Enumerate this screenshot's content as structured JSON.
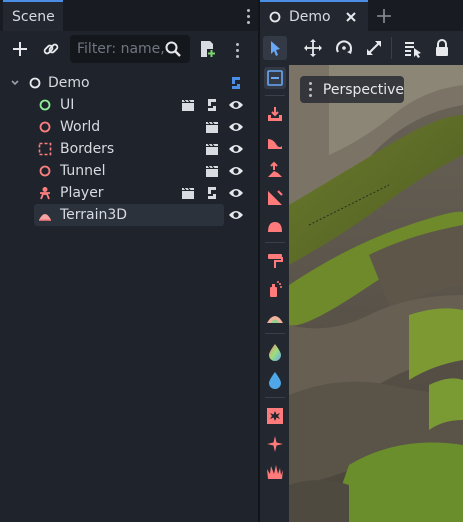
{
  "scene_dock": {
    "tab_label": "Scene",
    "filter_placeholder": "Filter: name,",
    "tree": [
      {
        "label": "Demo",
        "icon": "node3d-icon"
      },
      {
        "label": "UI",
        "icon": "control-icon"
      },
      {
        "label": "World",
        "icon": "node3d-icon"
      },
      {
        "label": "Borders",
        "icon": "node3d-icon"
      },
      {
        "label": "Tunnel",
        "icon": "node3d-icon"
      },
      {
        "label": "Player",
        "icon": "character-icon"
      },
      {
        "label": "Terrain3D",
        "icon": "terrain-icon"
      }
    ]
  },
  "viewport": {
    "tab_label": "Demo",
    "perspective_label": "Perspective"
  },
  "colors": {
    "accent": "#4b8ee6",
    "node3d": "#fc7f7f",
    "control": "#8eef97",
    "tool": "#ff7a7a"
  }
}
